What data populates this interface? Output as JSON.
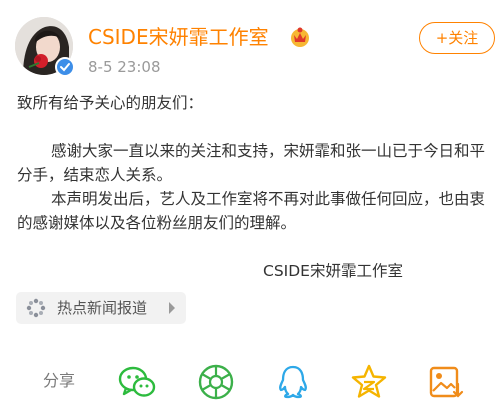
{
  "header": {
    "account_name": "CSIDE宋妍霏工作室",
    "post_time": "8-5 23:08",
    "follow_label": "+关注",
    "avatar_icon": "avatar-photo",
    "verified_icon": "verified-icon",
    "vip_icon": "vip-crown-icon"
  },
  "post": {
    "greeting": "致所有给予关心的朋友们：",
    "paragraph1": "感谢大家一直以来的关注和支持，宋妍霏和张一山已于今日和平分手，结束恋人关系。",
    "paragraph2": "本声明发出后，艺人及工作室将不再对此事做任何回应，也由衷的感谢媒体以及各位粉丝朋友们的理解。",
    "signature": "CSIDE宋妍霏工作室"
  },
  "topic": {
    "label": "热点新闻报道",
    "icon": "hot-news-icon"
  },
  "share": {
    "label": "分享",
    "targets": [
      {
        "name": "wechat",
        "icon": "wechat-icon",
        "color": "#2dbb3e"
      },
      {
        "name": "moments",
        "icon": "moments-icon",
        "color": "#3cb04a"
      },
      {
        "name": "qq",
        "icon": "qq-icon",
        "color": "#2da8e8"
      },
      {
        "name": "qzone",
        "icon": "qzone-icon",
        "color": "#f5b400"
      },
      {
        "name": "save-image",
        "icon": "save-image-icon",
        "color": "#f08c1a"
      }
    ]
  },
  "colors": {
    "brand_orange": "#ff8200",
    "text": "#333333",
    "muted": "#9a9a9a"
  }
}
